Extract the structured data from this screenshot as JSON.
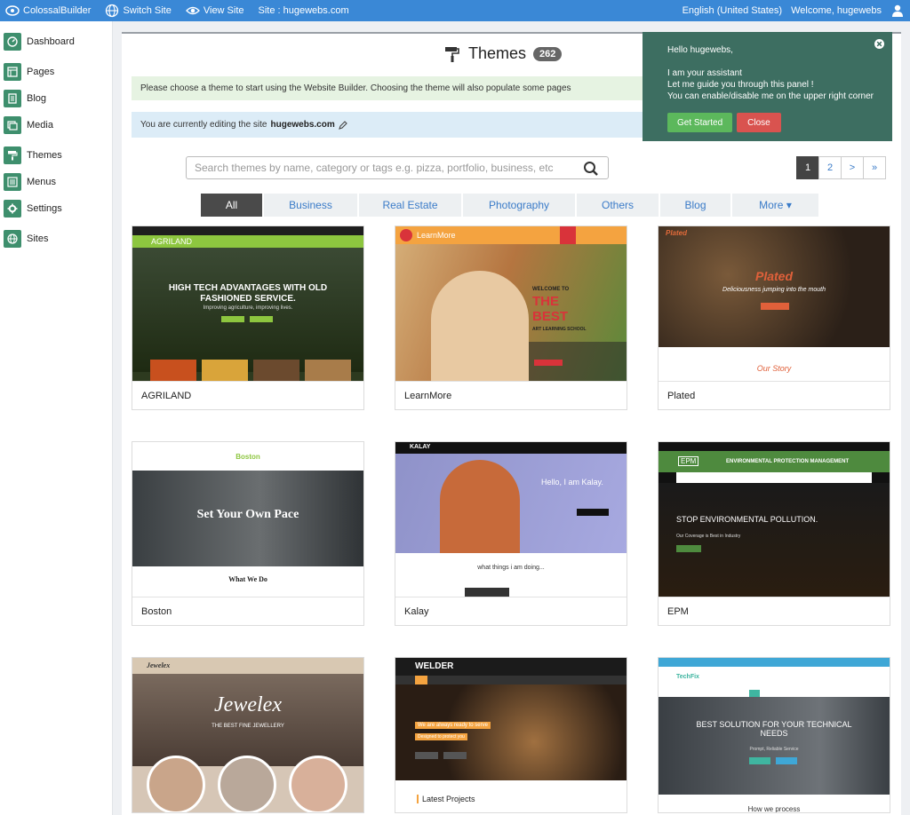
{
  "topbar": {
    "brand": "ColossalBuilder",
    "switch_site": "Switch Site",
    "view_site": "View Site",
    "site_label": "Site : hugewebs.com",
    "language": "English (United States)",
    "welcome": "Welcome, hugewebs"
  },
  "sidebar": {
    "items": [
      {
        "label": "Dashboard",
        "icon": "dashboard-icon"
      },
      {
        "label": "Pages",
        "icon": "pages-icon"
      },
      {
        "label": "Blog",
        "icon": "blog-icon"
      },
      {
        "label": "Media",
        "icon": "media-icon"
      },
      {
        "label": "Themes",
        "icon": "paint-roller-icon"
      },
      {
        "label": "Menus",
        "icon": "menus-icon"
      },
      {
        "label": "Settings",
        "icon": "gear-icon"
      },
      {
        "label": "Sites",
        "icon": "globe-icon"
      }
    ]
  },
  "header": {
    "title": "Themes",
    "count": "262"
  },
  "alerts": {
    "choose": "Please choose a theme to start using the Website Builder. Choosing the theme will also populate some pages",
    "editing_prefix": "You are currently editing the site",
    "editing_site": "hugewebs.com"
  },
  "search": {
    "placeholder": "Search themes by name, category or tags e.g. pizza, portfolio, business, etc"
  },
  "pagination": {
    "pages": [
      "1",
      "2"
    ],
    "next": ">",
    "last": "»"
  },
  "tabs": [
    "All",
    "Business",
    "Real Estate",
    "Photography",
    "Others",
    "Blog",
    "More ▾"
  ],
  "themes": [
    {
      "name": "AGRILAND",
      "preview": {
        "brand": "AGRILAND",
        "headline": "HIGH TECH ADVANTAGES WITH OLD FASHIONED SERVICE.",
        "sub": "Improving agriculture, improving lives."
      }
    },
    {
      "name": "LearnMore",
      "preview": {
        "brand": "LearnMore",
        "l1": "WELCOME TO",
        "l2": "THE",
        "l3": "BEST",
        "l4": "ART LEARNING SCHOOL"
      }
    },
    {
      "name": "Plated",
      "preview": {
        "brand": "Plated",
        "headline": "Plated",
        "sub": "Deliciousness jumping into the mouth",
        "section": "Our Story"
      }
    },
    {
      "name": "Boston",
      "preview": {
        "brand": "Boston",
        "headline": "Set Your Own Pace",
        "section": "What We Do"
      }
    },
    {
      "name": "Kalay",
      "preview": {
        "brand": "KALAY",
        "headline": "Hello, I am Kalay.",
        "section": "what things i am doing..."
      }
    },
    {
      "name": "EPM",
      "preview": {
        "brand": "EPM",
        "banner": "ENVIRONMENTAL PROTECTION MANAGEMENT",
        "headline": "STOP ENVIRONMENTAL POLLUTION.",
        "sub": "Our Coverage is Best in Industry"
      }
    },
    {
      "name": "Jewelex",
      "preview": {
        "brand": "Jewelex",
        "headline": "Jewelex",
        "sub": "THE BEST FINE JEWELLERY"
      }
    },
    {
      "name": "Welder",
      "preview": {
        "brand": "WELDER",
        "headline": "We are always ready to serve",
        "sub": "Designed to protect you",
        "section": "Latest Projects"
      }
    },
    {
      "name": "TechFix",
      "preview": {
        "brand": "TechFix",
        "headline": "BEST SOLUTION FOR YOUR TECHNICAL NEEDS",
        "sub": "Prompt, Reliable Service",
        "section": "How we process"
      }
    }
  ],
  "assistant": {
    "greeting": "Hello hugewebs,",
    "line1": "I am your assistant",
    "line2": "Let me guide you through this panel !",
    "line3": "You can enable/disable me on the upper right corner",
    "get_started": "Get Started",
    "close": "Close"
  },
  "colors": {
    "topbar": "#3a88d6",
    "sidebar_icon": "#3e8f6d",
    "assistant_bg": "#3d6e61",
    "btn_green": "#5cb85c",
    "btn_red": "#d9534f"
  }
}
